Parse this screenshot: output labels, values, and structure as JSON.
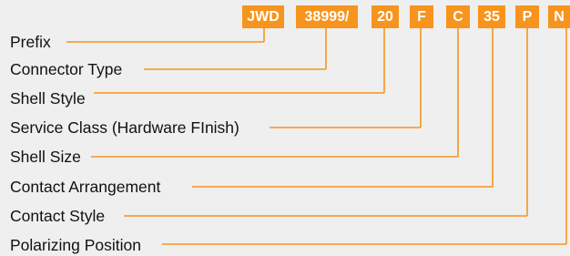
{
  "code_segments": [
    {
      "text": "JWD"
    },
    {
      "text": "38999/"
    },
    {
      "text": "20"
    },
    {
      "text": "F"
    },
    {
      "text": "C"
    },
    {
      "text": "35"
    },
    {
      "text": "P"
    },
    {
      "text": "N"
    }
  ],
  "labels": [
    {
      "text": "Prefix"
    },
    {
      "text": "Connector Type"
    },
    {
      "text": "Shell Style"
    },
    {
      "text": "Service Class (Hardware FInish)"
    },
    {
      "text": "Shell Size"
    },
    {
      "text": "Contact Arrangement"
    },
    {
      "text": "Contact Style"
    },
    {
      "text": "Polarizing Position"
    }
  ],
  "colors": {
    "accent": "#f7941d",
    "background": "#efefef",
    "text": "#111111"
  }
}
